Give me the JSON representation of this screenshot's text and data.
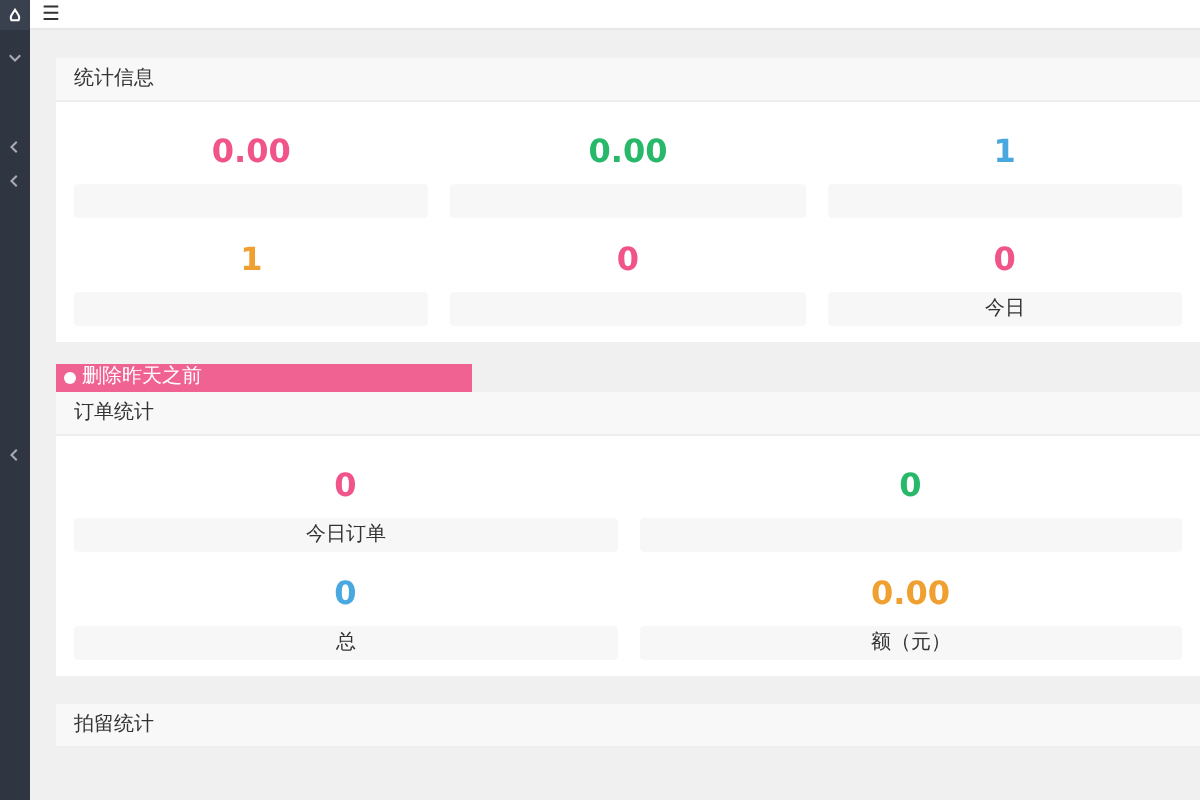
{
  "sidebar": {
    "items": [
      {
        "kind": "logo"
      },
      {
        "kind": "down"
      },
      {
        "kind": "left"
      },
      {
        "kind": "left"
      },
      {
        "kind": "left"
      }
    ]
  },
  "topbar": {
    "menu": "☰"
  },
  "panels": [
    {
      "title": "统计信息",
      "kind": "three-column",
      "stats": [
        {
          "value": "0.00",
          "color": "#f0548a"
        },
        {
          "value": "0.00",
          "color": "#27b86a"
        },
        {
          "value": "1",
          "color": "#4aa8e0"
        },
        {
          "value": "1",
          "color": "#f0a030"
        },
        {
          "value": "0",
          "color": "#f0548a"
        },
        {
          "value": "0",
          "color": "#f0548a",
          "label": "今日"
        }
      ]
    },
    {
      "banner": "删除昨天之前",
      "title": "订单统计",
      "kind": "two-column",
      "stats": [
        {
          "value": "0",
          "color": "#f0548a",
          "label": "今日订单"
        },
        {
          "value": "0",
          "color": "#27b86a"
        },
        {
          "value": "0",
          "color": "#4aa8e0",
          "label": "总"
        },
        {
          "value": "0.00",
          "color": "#f0a030",
          "label": "额（元）"
        }
      ]
    },
    {
      "title": "拍留统计",
      "kind": "header-only"
    }
  ]
}
